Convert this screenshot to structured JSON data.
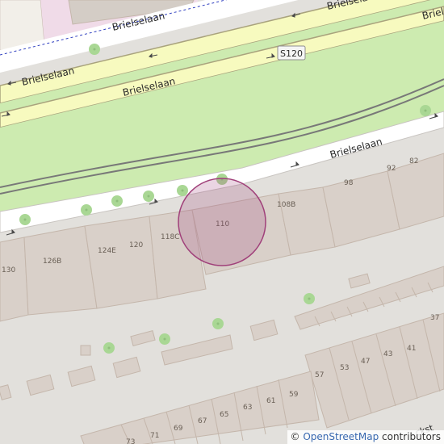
{
  "map": {
    "streets": {
      "main_road_upper": "Brielselaan",
      "main_road_lower": "Brielselaan",
      "main_road_lower_right": "Briel",
      "service_road_top": "Brielselaan",
      "service_road_top_right": "Brielselaan",
      "service_road_bottom": "Brielselaan",
      "bottom_street_fragment": "ckst"
    },
    "route_shield": "S120",
    "house_numbers": [
      "130",
      "126B",
      "124E",
      "120",
      "118C",
      "110",
      "108B",
      "98",
      "92",
      "82",
      "57",
      "53",
      "47",
      "43",
      "41",
      "37",
      "59",
      "61",
      "63",
      "65",
      "67",
      "69",
      "71",
      "73"
    ],
    "colors": {
      "background": "#e2e0dc",
      "park_green": "#cdebb0",
      "primary_road": "#f7fabf",
      "road_casing": "#a9a37d",
      "building": "#d9d0c9",
      "building_outline": "#c4b6ab",
      "tree": "#a9d794",
      "location_marker": "#a0407a"
    }
  },
  "attribution": {
    "copyright": "©",
    "link": "OpenStreetMap",
    "suffix": "contributors"
  }
}
